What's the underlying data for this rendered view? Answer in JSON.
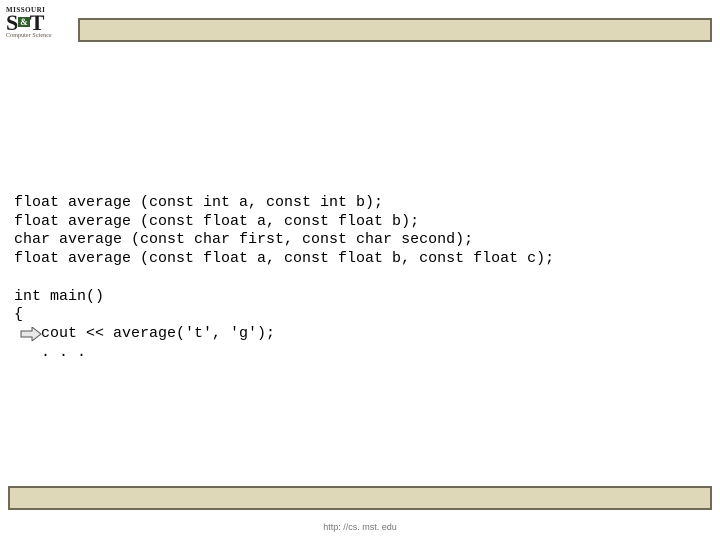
{
  "logo": {
    "line1": "MISSOURI",
    "big_left": "S",
    "amp": "&",
    "big_right": "T",
    "sub": "Computer Science"
  },
  "code": {
    "l1": "float average (const int a, const int b);",
    "l2": "float average (const float a, const float b);",
    "l3": "char average (const char first, const char second);",
    "l4": "float average (const float a, const float b, const float c);",
    "blank1": "",
    "l5": "int main()",
    "l6": "{",
    "l7": "   cout << average('t', 'g');",
    "l8": "   . . .",
    "indent": "   "
  },
  "footer": {
    "url": "http: //cs. mst. edu"
  }
}
